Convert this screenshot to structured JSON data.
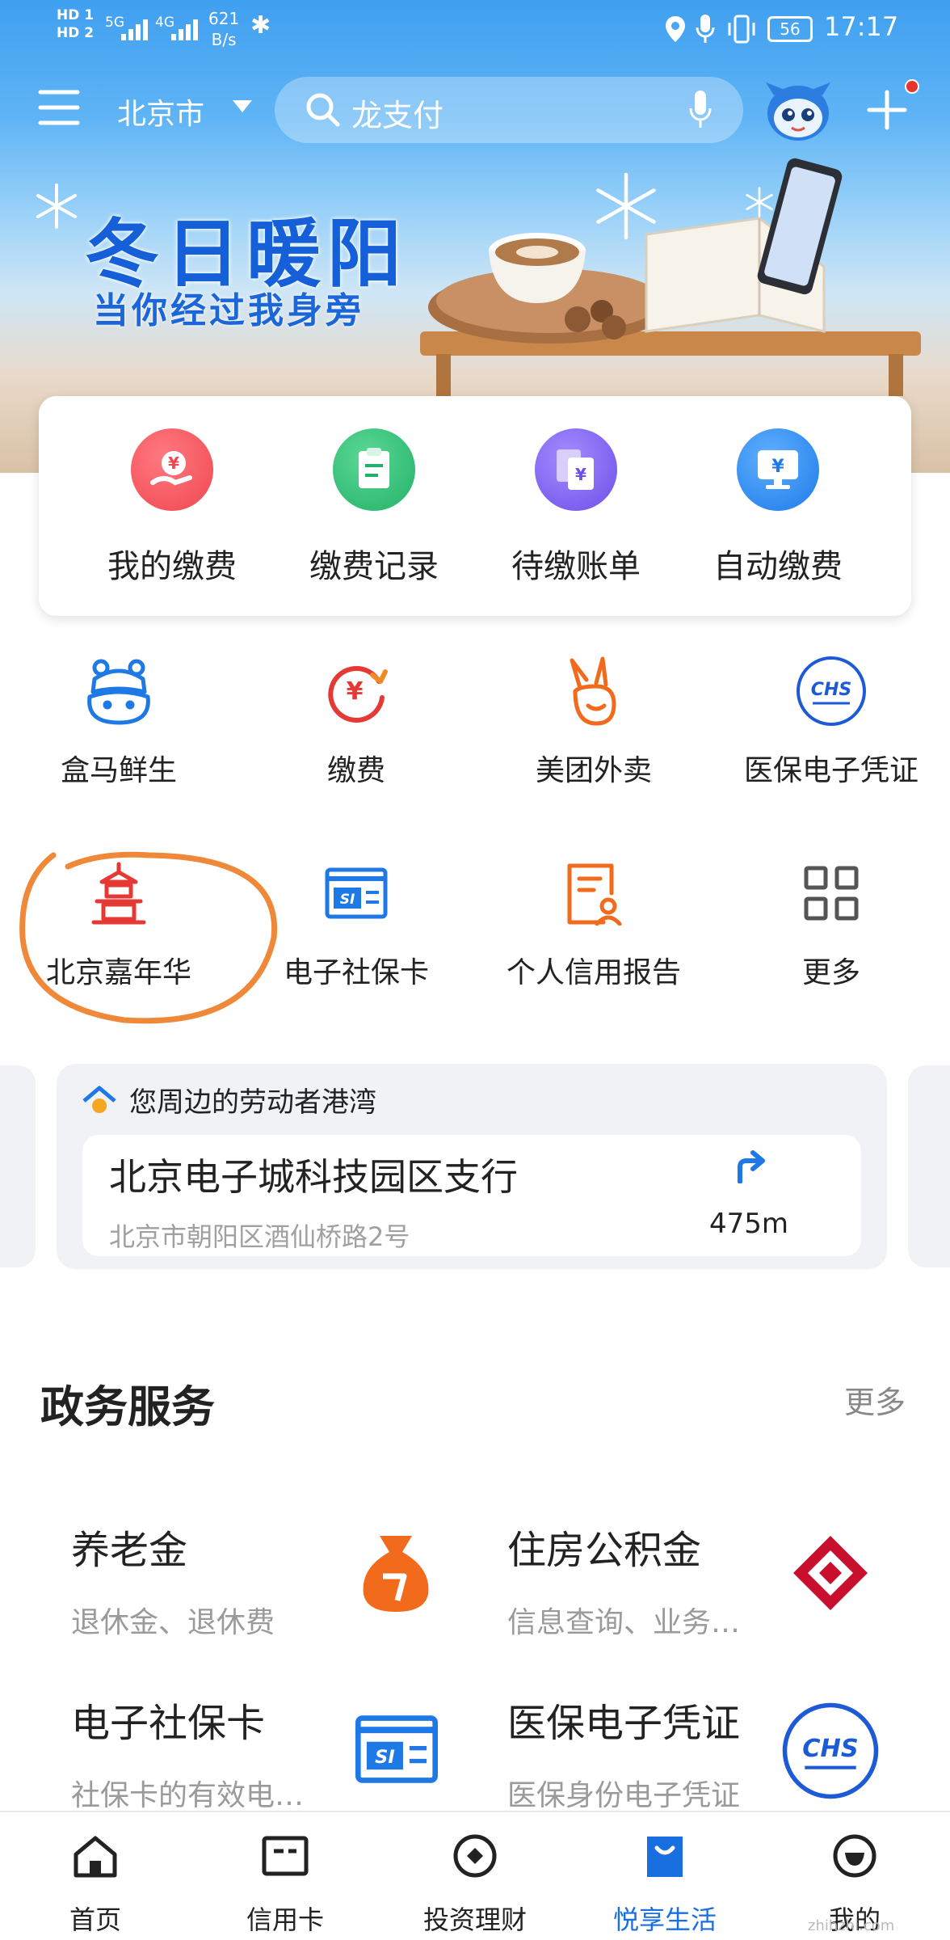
{
  "status_bar": {
    "hd_labels": [
      "HD 1",
      "HD 2"
    ],
    "signal_1": "5G",
    "signal_2": "4G",
    "net_speed_value": "621",
    "net_speed_unit": "B/s",
    "battery": "56",
    "time": "17:17"
  },
  "header": {
    "city": "北京市",
    "search_placeholder": "龙支付"
  },
  "banner": {
    "title": "冬日暖阳",
    "subtitle": "当你经过我身旁"
  },
  "payment_card": {
    "items": [
      {
        "label": "我的缴费",
        "icon": "hand-yen-icon",
        "color": "#f24d55"
      },
      {
        "label": "缴费记录",
        "icon": "receipt-icon",
        "color": "#2bbd72"
      },
      {
        "label": "待缴账单",
        "icon": "bill-icon",
        "color": "#7a5cf0"
      },
      {
        "label": "自动缴费",
        "icon": "monitor-yen-icon",
        "color": "#2d8bf0"
      }
    ]
  },
  "services": {
    "row1": [
      {
        "label": "盒马鲜生",
        "icon": "hippo-icon"
      },
      {
        "label": "缴费",
        "icon": "yen-cycle-icon"
      },
      {
        "label": "美团外卖",
        "icon": "kangaroo-icon"
      },
      {
        "label": "医保电子凭证",
        "icon": "chs-icon"
      }
    ],
    "row2": [
      {
        "label": "北京嘉年华",
        "icon": "pagoda-icon"
      },
      {
        "label": "电子社保卡",
        "icon": "si-card-icon"
      },
      {
        "label": "个人信用报告",
        "icon": "credit-report-icon"
      },
      {
        "label": "更多",
        "icon": "grid-icon"
      }
    ],
    "chs_text": "CHS",
    "si_text": "SI"
  },
  "location": {
    "heading": "您周边的劳动者港湾",
    "branch": "北京电子城科技园区支行",
    "address": "北京市朝阳区酒仙桥路2号",
    "distance": "475m"
  },
  "gov": {
    "title": "政务服务",
    "more": "更多",
    "items": [
      {
        "title": "养老金",
        "desc": "退休金、退休费",
        "icon": "money-bag-icon"
      },
      {
        "title": "住房公积金",
        "desc": "信息查询、业务…",
        "icon": "housing-fund-icon"
      },
      {
        "title": "电子社保卡",
        "desc": "社保卡的有效电…",
        "icon": "si-card-icon"
      },
      {
        "title": "医保电子凭证",
        "desc": "医保身份电子凭证",
        "icon": "chs-icon"
      }
    ]
  },
  "tabbar": {
    "items": [
      {
        "label": "首页",
        "icon": "home-icon"
      },
      {
        "label": "信用卡",
        "icon": "card-icon"
      },
      {
        "label": "投资理财",
        "icon": "diamond-coin-icon"
      },
      {
        "label": "悦享生活",
        "icon": "bag-icon",
        "active": true
      },
      {
        "label": "我的",
        "icon": "smile-icon"
      }
    ],
    "active_color": "#1a6fe0"
  },
  "watermark": "zhihzhi.com"
}
